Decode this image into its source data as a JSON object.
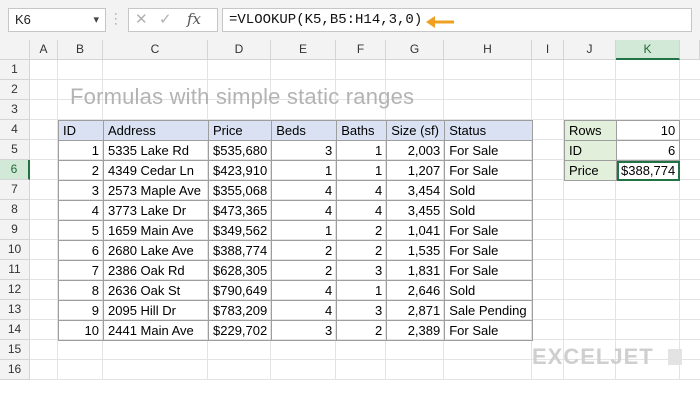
{
  "formula_bar": {
    "name_box": "K6",
    "cancel_icon": "✕",
    "enter_icon": "✓",
    "fx_label": "fx",
    "formula": "=VLOOKUP(K5,B5:H14,3,0)"
  },
  "columns": [
    "A",
    "B",
    "C",
    "D",
    "E",
    "F",
    "G",
    "H",
    "I",
    "J",
    "K"
  ],
  "rows": [
    "1",
    "2",
    "3",
    "4",
    "5",
    "6",
    "7",
    "8",
    "9",
    "10",
    "11",
    "12",
    "13",
    "14",
    "15",
    "16"
  ],
  "selected_cell": {
    "column": "K",
    "row": "6"
  },
  "title": "Formulas with simple static ranges",
  "table": {
    "headers": [
      "ID",
      "Address",
      "Price",
      "Beds",
      "Baths",
      "Size (sf)",
      "Status"
    ],
    "rows": [
      [
        "1",
        "5335 Lake Rd",
        "$535,680",
        "3",
        "1",
        "2,003",
        "For Sale"
      ],
      [
        "2",
        "4349 Cedar Ln",
        "$423,910",
        "1",
        "1",
        "1,207",
        "For Sale"
      ],
      [
        "3",
        "2573 Maple Ave",
        "$355,068",
        "4",
        "4",
        "3,454",
        "Sold"
      ],
      [
        "4",
        "3773 Lake Dr",
        "$473,365",
        "4",
        "4",
        "3,455",
        "Sold"
      ],
      [
        "5",
        "1659 Main Ave",
        "$349,562",
        "1",
        "2",
        "1,041",
        "For Sale"
      ],
      [
        "6",
        "2680 Lake Ave",
        "$388,774",
        "2",
        "2",
        "1,535",
        "For Sale"
      ],
      [
        "7",
        "2386 Oak Rd",
        "$628,305",
        "2",
        "3",
        "1,831",
        "For Sale"
      ],
      [
        "8",
        "2636 Oak St",
        "$790,649",
        "4",
        "1",
        "2,646",
        "Sold"
      ],
      [
        "9",
        "2095 Hill Dr",
        "$783,209",
        "4",
        "3",
        "2,871",
        "Sale Pending"
      ],
      [
        "10",
        "2441 Main Ave",
        "$229,702",
        "3",
        "2",
        "2,389",
        "For Sale"
      ]
    ]
  },
  "lookup": {
    "rows_label": "Rows",
    "rows_value": "10",
    "id_label": "ID",
    "id_value": "6",
    "price_label": "Price",
    "price_value": "$388,774"
  },
  "logo": "EXCELJET",
  "colors": {
    "accent": "#217346",
    "header_fill": "#d9e1f2",
    "label_fill": "#e2efda",
    "arrow": "#f0a020"
  }
}
